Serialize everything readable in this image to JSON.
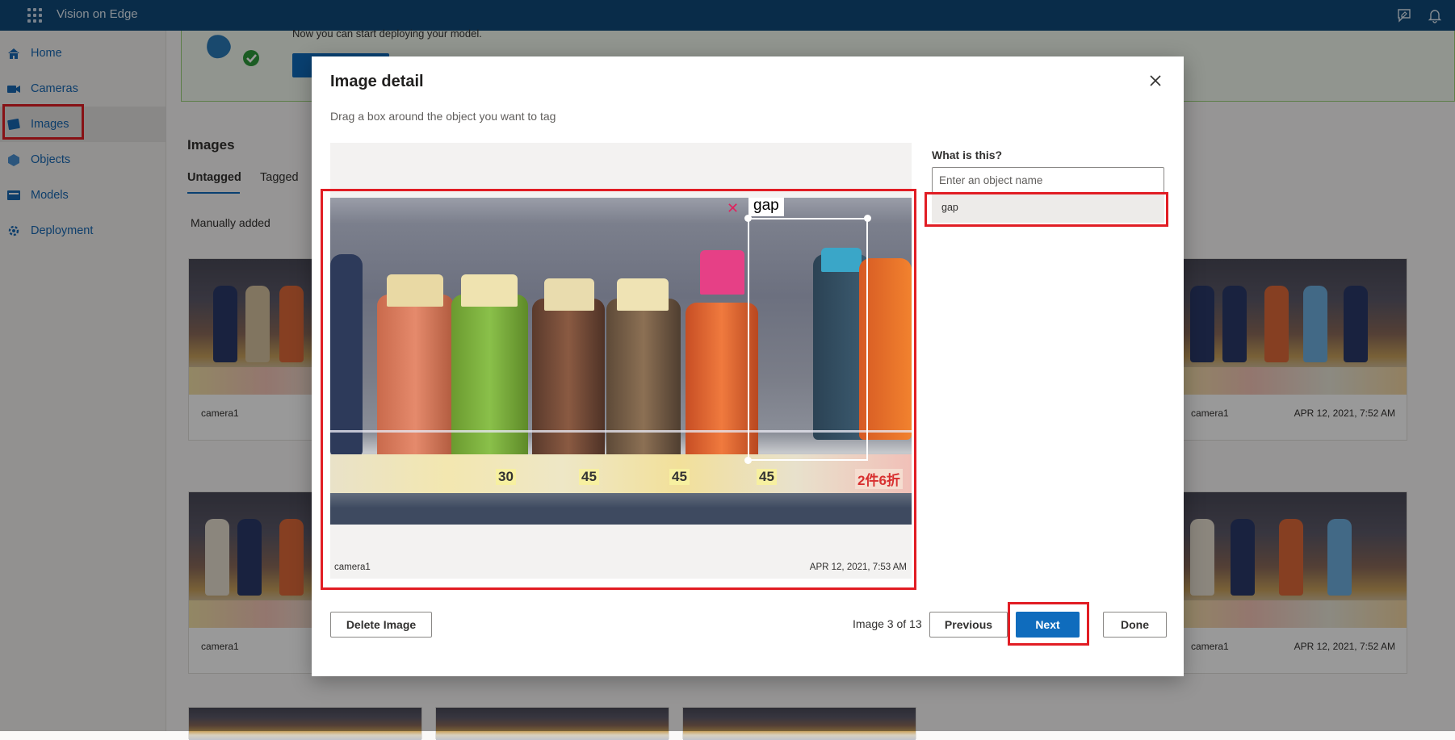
{
  "app": {
    "title": "Vision on Edge"
  },
  "topbar": {
    "icons": [
      "feedback-icon",
      "bell-icon"
    ]
  },
  "sidebar": {
    "items": [
      {
        "label": "Home",
        "icon": "home-icon"
      },
      {
        "label": "Cameras",
        "icon": "camera-icon"
      },
      {
        "label": "Images",
        "icon": "images-icon",
        "active": true
      },
      {
        "label": "Objects",
        "icon": "objects-icon"
      },
      {
        "label": "Models",
        "icon": "models-icon"
      },
      {
        "label": "Deployment",
        "icon": "deployment-icon"
      }
    ]
  },
  "banner": {
    "text": "Now you can start deploying your model."
  },
  "page": {
    "title": "Images",
    "tabs": [
      "Untagged",
      "Tagged"
    ],
    "active_tab": "Untagged",
    "section": "Manually added"
  },
  "cards": [
    {
      "camera": "camera1",
      "time": ""
    },
    {
      "camera": "camera1",
      "time": "APR 12, 2021, 7:52 AM"
    },
    {
      "camera": "camera1",
      "time": ""
    },
    {
      "camera": "camera1",
      "time": "APR 12, 2021, 7:52 AM"
    }
  ],
  "modal": {
    "title": "Image detail",
    "subtitle": "Drag a box around the object you want to tag",
    "image_camera": "camera1",
    "image_time": "APR 12, 2021, 7:53 AM",
    "bbox_label": "gap",
    "question": "What is this?",
    "input_placeholder": "Enter an object name",
    "suggestion": "gap",
    "delete_label": "Delete Image",
    "pager": "Image 3 of 13",
    "previous_label": "Previous",
    "next_label": "Next",
    "done_label": "Done"
  },
  "photo_prices": [
    "30",
    "45",
    "45",
    "45",
    "2件6折"
  ],
  "colors": {
    "topbar": "#0f4a7a",
    "accent": "#0f6cbd",
    "highlight": "#e11d24"
  }
}
